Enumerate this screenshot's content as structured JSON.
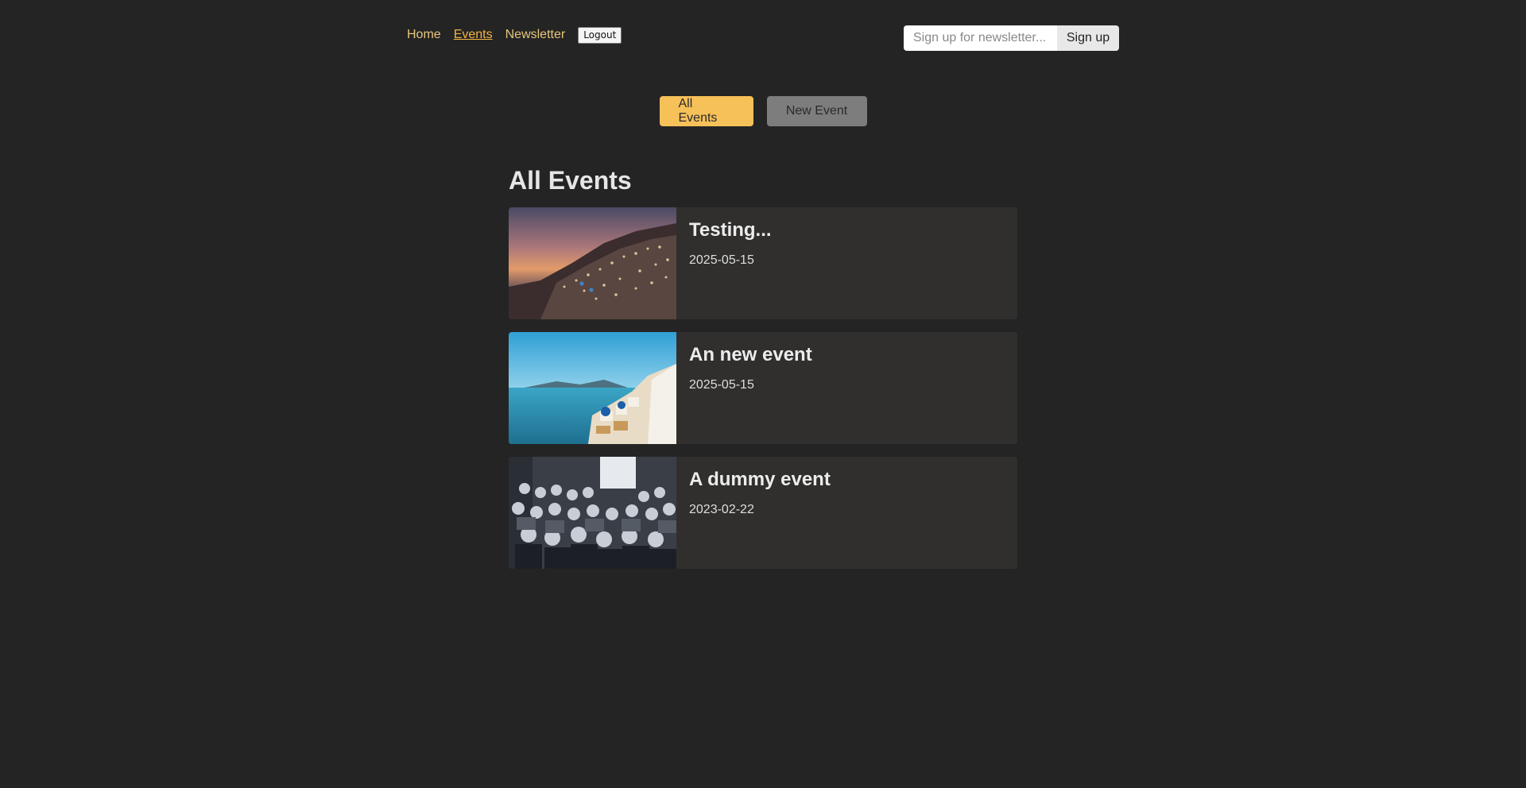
{
  "header": {
    "nav": {
      "home": "Home",
      "events": "Events",
      "newsletter": "Newsletter",
      "logout": "Logout"
    },
    "signup": {
      "placeholder": "Sign up for newsletter...",
      "button": "Sign up"
    }
  },
  "actions": {
    "all_events": "All Events",
    "new_event": "New Event"
  },
  "main": {
    "title": "All Events",
    "events": [
      {
        "title": "Testing...",
        "date": "2025-05-15",
        "image": "santorini-sunset-image"
      },
      {
        "title": "An new event",
        "date": "2025-05-15",
        "image": "santorini-day-image"
      },
      {
        "title": "A dummy event",
        "date": "2023-02-22",
        "image": "conference-crowd-image"
      }
    ]
  },
  "colors": {
    "background": "#242424",
    "accent": "#f7c159",
    "nav_link": "#e8c67c",
    "active_link": "#f1b545",
    "card": "#302f2e",
    "secondary_button": "#7d7d7d"
  }
}
